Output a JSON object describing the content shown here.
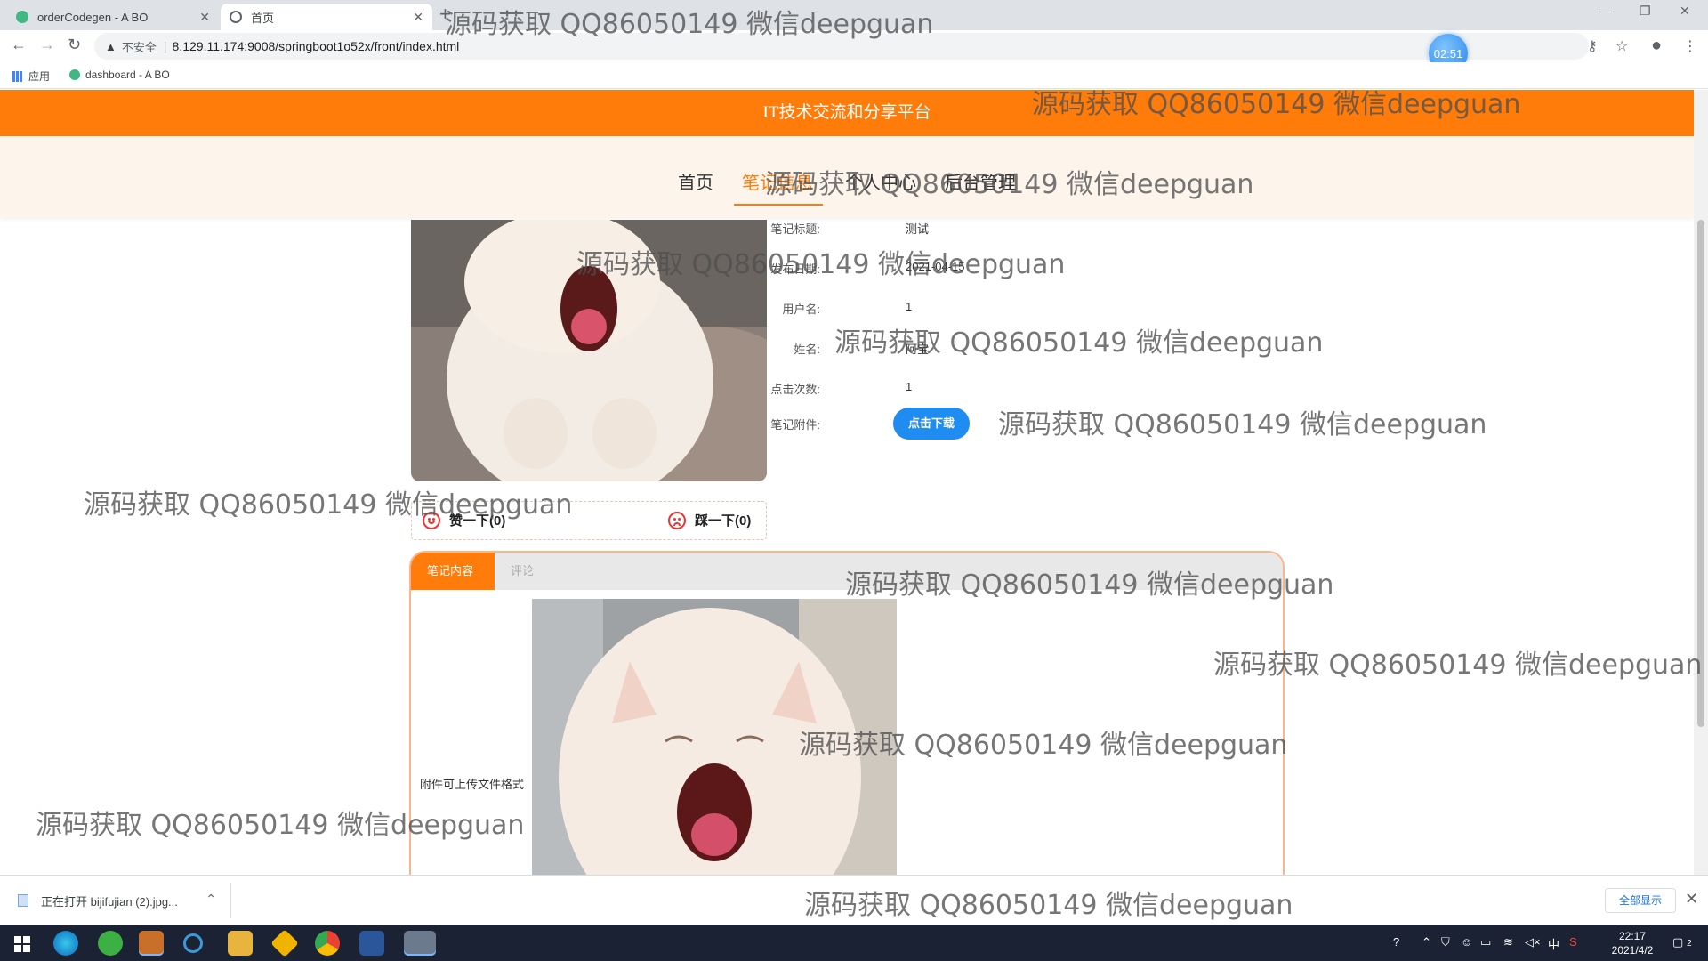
{
  "browser": {
    "tabs": [
      {
        "title": "orderCodegen - A BO",
        "active": false
      },
      {
        "title": "首页",
        "active": true
      }
    ],
    "new_tab": "+",
    "address": {
      "security_label": "不安全",
      "url": "8.129.11.174:9008/springboot1o52x/front/index.html"
    },
    "timer": "02:51",
    "bookmarks": [
      {
        "label": "应用"
      },
      {
        "label": "dashboard - A BO"
      }
    ]
  },
  "site": {
    "header_title": "IT技术交流和分享平台",
    "nav": [
      {
        "label": "首页",
        "active": false
      },
      {
        "label": "笔记信息",
        "active": true
      },
      {
        "label": "个人中心",
        "active": false
      },
      {
        "label": "后台管理",
        "active": false
      }
    ]
  },
  "note": {
    "fields": [
      {
        "label": "笔记标题:",
        "value": "测试"
      },
      {
        "label": "发布日期:",
        "value": "2021-04-15"
      },
      {
        "label": "用户名:",
        "value": "1"
      },
      {
        "label": "姓名:",
        "value": "阿宝"
      },
      {
        "label": "点击次数:",
        "value": "1"
      },
      {
        "label": "笔记附件:",
        "value": ""
      }
    ],
    "download_label": "点击下载",
    "like_label": "赞一下(0)",
    "dislike_label": "踩一下(0)",
    "tabs": [
      {
        "label": "笔记内容",
        "active": true
      },
      {
        "label": "评论",
        "active": false
      }
    ],
    "content_text": "附件可上传文件格式"
  },
  "download_bar": {
    "item_label": "正在打开 bijifujian (2).jpg...",
    "show_all": "全部显示",
    "close": "✕"
  },
  "taskbar": {
    "time": "22:17",
    "date": "2021/4/2",
    "ime": "中",
    "notification_count": "2"
  },
  "watermark_text": "源码获取 QQ86050149 微信deepguan",
  "colors": {
    "brand_orange": "#ff7c0a",
    "download_blue": "#1e8cf0",
    "nav_bg": "#fdf4ec"
  }
}
